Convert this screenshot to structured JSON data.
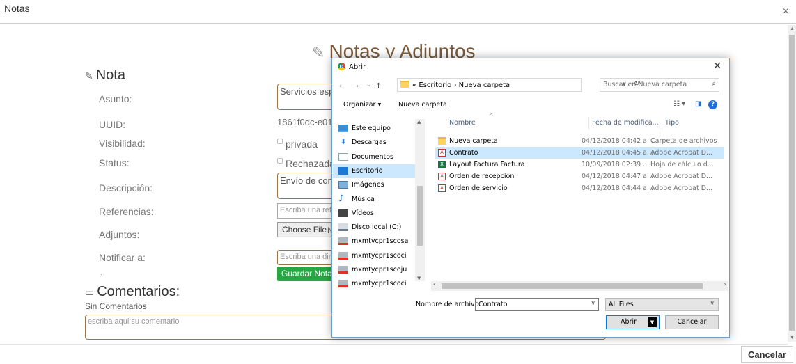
{
  "modal": {
    "title": "Notas",
    "close_glyph": "×",
    "cancel_label": "Cancelar"
  },
  "page": {
    "heading": "Notas y Adjuntos",
    "heading_icon": "edit-icon",
    "nota_title": "Nota",
    "comentarios_title": "Comentarios:",
    "sin_comentarios": "Sin Comentarios",
    "comment_placeholder": "escriba aqui su comentario",
    "dot": "."
  },
  "form": {
    "asunto_label": "Asunto:",
    "asunto_value": "Servicios espe",
    "uuid_label": "UUID:",
    "uuid_value": "1861f0dc-e015",
    "visibilidad_label": "Visibilidad:",
    "visibilidad_option": "privada",
    "status_label": "Status:",
    "status_option": "Rechazada",
    "descripcion_label": "Descripción:",
    "descripcion_value": "Envío de contr",
    "referencias_label": "Referencias:",
    "referencias_placeholder": "Escriba una refe",
    "adjuntos_label": "Adjuntos:",
    "choose_file_label": "Choose File",
    "choose_file_suffix": "N",
    "notificar_label": "Notificar a:",
    "notificar_placeholder": "Escriba una dire",
    "guardar_label": "Guardar Nota"
  },
  "dialog": {
    "title": "Abrir",
    "close_glyph": "✕",
    "nav_back": "←",
    "nav_forward": "→",
    "nav_recent": "⌄",
    "nav_up": "↑",
    "address_prefix": "«",
    "address_path": [
      "Escritorio",
      "Nueva carpeta"
    ],
    "address_sep": "›",
    "search_placeholder": "Buscar en Nueva carpeta",
    "toolbar": {
      "organize": "Organizar ▾",
      "new_folder": "Nueva carpeta",
      "view_glyph": "☷ ▾",
      "pane_glyph": "◨",
      "help_glyph": "?"
    },
    "nav_items": [
      {
        "label": "Este equipo",
        "icon": "ni-pc"
      },
      {
        "label": "Descargas",
        "icon": "ni-dl"
      },
      {
        "label": "Documentos",
        "icon": "ni-doc"
      },
      {
        "label": "Escritorio",
        "icon": "ni-desk",
        "selected": true
      },
      {
        "label": "Imágenes",
        "icon": "ni-img"
      },
      {
        "label": "Música",
        "icon": "ni-mus"
      },
      {
        "label": "Vídeos",
        "icon": "ni-vid"
      },
      {
        "label": "Disco local (C:)",
        "icon": "ni-disk"
      },
      {
        "label": "mxmtycpr1scosa",
        "icon": "ni-net"
      },
      {
        "label": "mxmtycpr1scoci",
        "icon": "ni-net"
      },
      {
        "label": "mxmtycpr1scoju",
        "icon": "ni-net"
      },
      {
        "label": "mxmtycpr1scoci",
        "icon": "ni-net"
      }
    ],
    "columns": {
      "name": "Nombre",
      "date": "Fecha de modifica...",
      "type": "Tipo"
    },
    "files": [
      {
        "name": "Nueva carpeta",
        "date": "04/12/2018 04:42 a...",
        "type": "Carpeta de archivos",
        "icon": "fi-folder"
      },
      {
        "name": "Contrato",
        "date": "04/12/2018 04:45 a...",
        "type": "Adobe Acrobat D...",
        "icon": "fi-pdf",
        "selected": true
      },
      {
        "name": "Layout Factura Factura",
        "date": "10/09/2018 02:39 ...",
        "type": "Hoja de cálculo d...",
        "icon": "fi-xls"
      },
      {
        "name": "Orden de recepción",
        "date": "04/12/2018 04:47 a...",
        "type": "Adobe Acrobat D...",
        "icon": "fi-pdf"
      },
      {
        "name": "Orden de servicio",
        "date": "04/12/2018 04:44 a...",
        "type": "Adobe Acrobat D...",
        "icon": "fi-pdf"
      }
    ],
    "filename_label": "Nombre de archivo:",
    "filename_value": "Contrato",
    "filetype_value": "All Files",
    "open_label": "Abrir",
    "cancel_label": "Cancelar"
  }
}
